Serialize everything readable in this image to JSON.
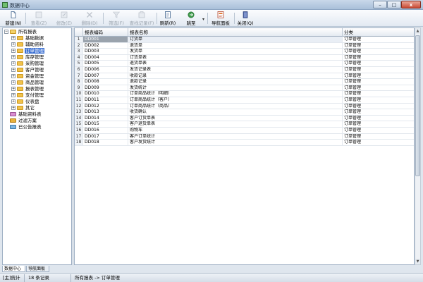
{
  "window": {
    "title": "数据中心",
    "min_label": "–",
    "max_label": "□",
    "close_label": "x"
  },
  "toolbar": {
    "items": [
      {
        "label": "新建(N)",
        "icon": "new-document-icon",
        "enabled": true
      },
      {
        "label": "查看(Z)",
        "icon": "view-icon",
        "enabled": false
      },
      {
        "label": "修改(E)",
        "icon": "edit-icon",
        "enabled": false
      },
      {
        "label": "删除(D)",
        "icon": "delete-icon",
        "enabled": false
      },
      {
        "label": "筛选(F)",
        "icon": "filter-icon",
        "enabled": false
      },
      {
        "label": "查找记录(F)",
        "icon": "find-record-icon",
        "enabled": false
      },
      {
        "label": "刷新(R)",
        "icon": "refresh-icon",
        "enabled": true
      },
      {
        "label": "跳至",
        "icon": "goto-icon",
        "enabled": true
      },
      {
        "label": "导航面板",
        "icon": "navigation-panel-icon",
        "enabled": true
      },
      {
        "label": "关闭(Q)",
        "icon": "close-panel-icon",
        "enabled": true
      }
    ]
  },
  "tree": {
    "root": "所有报表",
    "groups": [
      "基础数据",
      "辅助资料",
      "订单管理",
      "库存管理",
      "采购管理",
      "客户管理",
      "资金管理",
      "商品管理",
      "报表管理",
      "支付管理",
      "仪表盘",
      "其它"
    ],
    "selected_group": "订单管理",
    "extra": [
      "基础资料表",
      "过滤方案",
      "已公告报表"
    ]
  },
  "grid": {
    "columns": [
      "报表编码",
      "报表名称",
      "分类"
    ],
    "rows": [
      {
        "no": "1",
        "code": "DD001",
        "name": "订货单",
        "category": "订单管理"
      },
      {
        "no": "2",
        "code": "DD002",
        "name": "退货单",
        "category": "订单管理"
      },
      {
        "no": "3",
        "code": "DD003",
        "name": "发货单",
        "category": "订单管理"
      },
      {
        "no": "4",
        "code": "DD004",
        "name": "订货单表",
        "category": "订单管理"
      },
      {
        "no": "5",
        "code": "DD005",
        "name": "退货单表",
        "category": "订单管理"
      },
      {
        "no": "6",
        "code": "DD006",
        "name": "发货记录表",
        "category": "订单管理"
      },
      {
        "no": "7",
        "code": "DD007",
        "name": "收款记录",
        "category": "订单管理"
      },
      {
        "no": "8",
        "code": "DD008",
        "name": "退款记录",
        "category": "订单管理"
      },
      {
        "no": "9",
        "code": "DD009",
        "name": "发货统计",
        "category": "订单管理"
      },
      {
        "no": "10",
        "code": "DD010",
        "name": "订单商品统计（明细）",
        "category": "订单管理"
      },
      {
        "no": "11",
        "code": "DD011",
        "name": "订单商品统计（客户）",
        "category": "订单管理"
      },
      {
        "no": "12",
        "code": "DD012",
        "name": "订单商品统计（商品）",
        "category": "订单管理"
      },
      {
        "no": "13",
        "code": "DD013",
        "name": "收货确认",
        "category": "订单管理"
      },
      {
        "no": "14",
        "code": "DD014",
        "name": "客户订货单表",
        "category": "订单管理"
      },
      {
        "no": "15",
        "code": "DD015",
        "name": "客户退货单表",
        "category": "订单管理"
      },
      {
        "no": "16",
        "code": "DD016",
        "name": "购物车",
        "category": "订单管理"
      },
      {
        "no": "17",
        "code": "DD017",
        "name": "客户订单统计",
        "category": "订单管理"
      },
      {
        "no": "18",
        "code": "DD018",
        "name": "客户发货统计",
        "category": "订单管理"
      }
    ]
  },
  "tabs": [
    "数据中心",
    "导航面板"
  ],
  "status": {
    "left": "[主]统计",
    "count": "18 条记录",
    "path": "所有报表 -> 订单管理"
  }
}
